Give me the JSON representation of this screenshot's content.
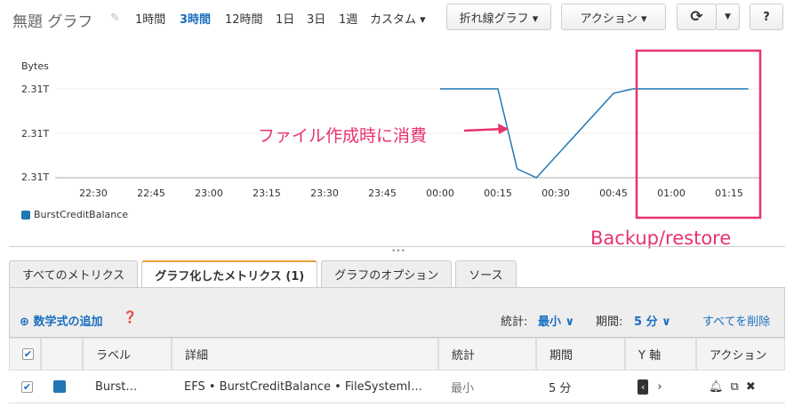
{
  "header": {
    "title": "無題 グラフ",
    "ranges": [
      "1時間",
      "3時間",
      "12時間",
      "1日",
      "3日",
      "1週",
      "カスタム ▾"
    ],
    "active_range": "3時間",
    "chart_type": "折れ線グラフ ▾",
    "actions": "アクション ▾",
    "refresh_icon": "refresh-icon",
    "help": "?"
  },
  "chart_data": {
    "type": "line",
    "ylabel": "Bytes",
    "yticks": [
      "2.31T",
      "2.31T",
      "2.31T"
    ],
    "ylim": [
      2.31,
      2.312
    ],
    "xticks": [
      "22:30",
      "22:45",
      "23:00",
      "23:15",
      "23:30",
      "23:45",
      "00:00",
      "00:15",
      "00:30",
      "00:45",
      "01:00",
      "01:15"
    ],
    "x_minutes_from_2230": [
      90,
      105,
      110,
      115,
      135,
      140,
      170
    ],
    "series": [
      {
        "name": "BurstCreditBalance",
        "color": "#1f77b4",
        "values": [
          2.312,
          2.312,
          2.3102,
          2.31,
          2.3119,
          2.312,
          2.312
        ]
      }
    ]
  },
  "annotations": {
    "consume": "ファイル作成時に消費",
    "backup": "Backup/restore",
    "color": "#e8336d"
  },
  "tabs": [
    "すべてのメトリクス",
    "グラフ化したメトリクス (1)",
    "グラフのオプション",
    "ソース"
  ],
  "toolbar": {
    "add_math": "数学式の追加",
    "stat_label": "統計:",
    "stat_value": "最小 ∨",
    "period_label": "期間:",
    "period_value": "5 分 ∨",
    "delete_all": "すべてを削除"
  },
  "table": {
    "headers": [
      "ラベル",
      "詳細",
      "統計",
      "期間",
      "Y 軸",
      "アクション"
    ],
    "rows": [
      {
        "label": "Burst…",
        "detail": "EFS • BurstCreditBalance • FileSystemI…",
        "stat": "最小",
        "period": "5 分",
        "color": "#1f77b4"
      }
    ]
  }
}
